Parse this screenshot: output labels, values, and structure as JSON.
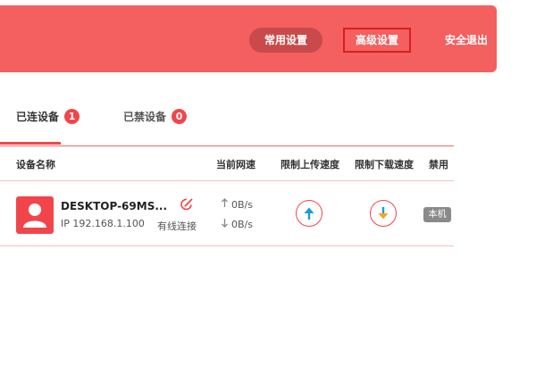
{
  "header": {
    "nav": {
      "common_settings": "常用设置",
      "advanced_settings": "高级设置",
      "logout": "安全退出"
    }
  },
  "tabs": {
    "connected": {
      "label": "已连设备",
      "count": "1"
    },
    "blocked": {
      "label": "已禁设备",
      "count": "0"
    }
  },
  "table": {
    "headers": {
      "device_name": "设备名称",
      "current_speed": "当前网速",
      "limit_upload": "限制上传速度",
      "limit_download": "限制下载速度",
      "disable": "禁用"
    },
    "rows": [
      {
        "name": "DESKTOP-69MS...",
        "ip": "IP 192.168.1.100",
        "connection": "有线连接",
        "upload_speed": "0B/s",
        "download_speed": "0B/s",
        "tag": "本机"
      }
    ]
  },
  "colors": {
    "brand_red": "#f45f5f",
    "accent_red": "#f2454b",
    "upload_arrow": "#1e9bd7",
    "download_arrow": "#f5a623"
  },
  "icons": {
    "avatar": "user-icon",
    "edit": "edit-icon",
    "up_arrow": "arrow-up-icon",
    "down_arrow": "arrow-down-icon"
  }
}
